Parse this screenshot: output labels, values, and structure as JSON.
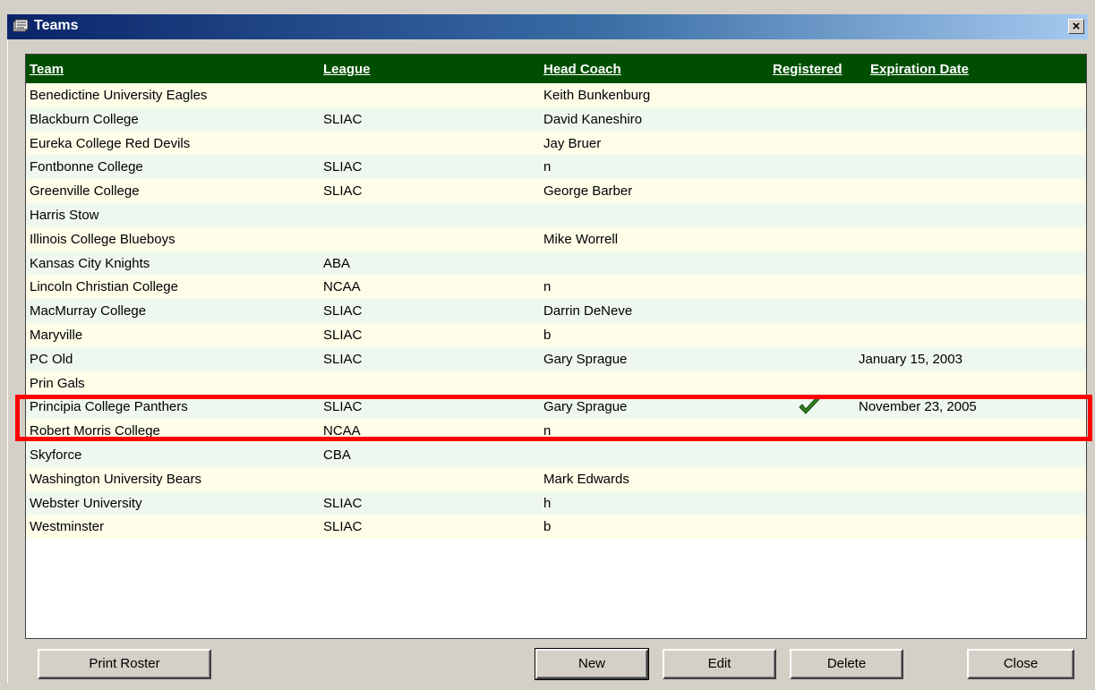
{
  "window": {
    "title": "Teams",
    "close_glyph": "×"
  },
  "table": {
    "columns": [
      "Team",
      "League",
      "Head Coach",
      "Registered",
      "Expiration Date"
    ],
    "rows": [
      {
        "team": "Benedictine University Eagles",
        "league": "",
        "coach": "Keith Bunkenburg",
        "registered": false,
        "expiration": ""
      },
      {
        "team": "Blackburn College",
        "league": "SLIAC",
        "coach": "David Kaneshiro",
        "registered": false,
        "expiration": ""
      },
      {
        "team": "Eureka College Red Devils",
        "league": "",
        "coach": "Jay Bruer",
        "registered": false,
        "expiration": ""
      },
      {
        "team": "Fontbonne College",
        "league": "SLIAC",
        "coach": "n",
        "registered": false,
        "expiration": ""
      },
      {
        "team": "Greenville College",
        "league": "SLIAC",
        "coach": "George Barber",
        "registered": false,
        "expiration": ""
      },
      {
        "team": "Harris Stow",
        "league": "",
        "coach": "",
        "registered": false,
        "expiration": ""
      },
      {
        "team": "Illinois College Blueboys",
        "league": "",
        "coach": "Mike Worrell",
        "registered": false,
        "expiration": ""
      },
      {
        "team": "Kansas City Knights",
        "league": "ABA",
        "coach": "",
        "registered": false,
        "expiration": ""
      },
      {
        "team": "Lincoln Christian College",
        "league": "NCAA",
        "coach": "n",
        "registered": false,
        "expiration": ""
      },
      {
        "team": "MacMurray College",
        "league": "SLIAC",
        "coach": "Darrin DeNeve",
        "registered": false,
        "expiration": ""
      },
      {
        "team": "Maryville",
        "league": "SLIAC",
        "coach": "b",
        "registered": false,
        "expiration": ""
      },
      {
        "team": "PC Old",
        "league": "SLIAC",
        "coach": "Gary Sprague",
        "registered": false,
        "expiration": "January 15, 2003"
      },
      {
        "team": "Prin Gals",
        "league": "",
        "coach": "",
        "registered": false,
        "expiration": ""
      },
      {
        "team": "Principia College Panthers",
        "league": "SLIAC",
        "coach": "Gary Sprague",
        "registered": true,
        "expiration": "November 23, 2005"
      },
      {
        "team": "Robert Morris College",
        "league": "NCAA",
        "coach": "n",
        "registered": false,
        "expiration": ""
      },
      {
        "team": "Skyforce",
        "league": "CBA",
        "coach": "",
        "registered": false,
        "expiration": ""
      },
      {
        "team": "Washington University Bears",
        "league": "",
        "coach": "Mark Edwards",
        "registered": false,
        "expiration": ""
      },
      {
        "team": "Webster University",
        "league": "SLIAC",
        "coach": "h",
        "registered": false,
        "expiration": ""
      },
      {
        "team": "Westminster",
        "league": "SLIAC",
        "coach": "b",
        "registered": false,
        "expiration": ""
      }
    ]
  },
  "buttons": {
    "print_roster": "Print Roster",
    "new": "New",
    "edit": "Edit",
    "delete": "Delete",
    "close": "Close"
  },
  "colors": {
    "header_bg": "#004f00",
    "row_odd": "#fdfde8",
    "row_even": "#eef8ef",
    "check": "#2e7d1e",
    "highlight": "#ff0000"
  }
}
